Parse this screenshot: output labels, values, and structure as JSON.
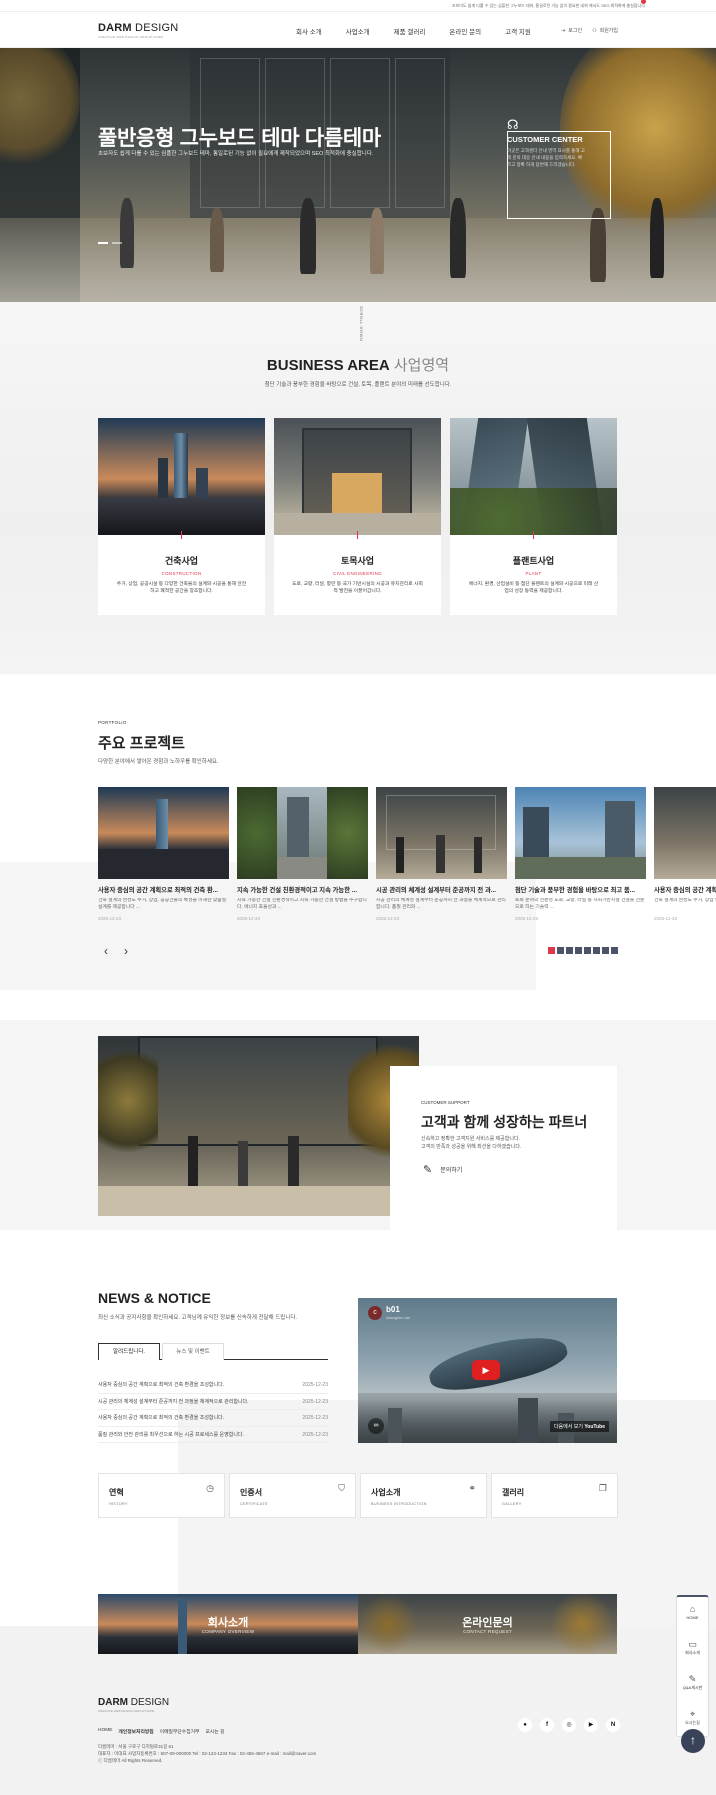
{
  "notice": "조보이도 쉽게 다룰 수 있는 심플한 그누보드 테마, 통일로된 기능 없이 필요한 네위 에서도 SEO 최적화에 충실합니다.",
  "header": {
    "logo_bold": "DARM",
    "logo_light": " DESIGN",
    "logo_tagline": "CREATIVE WEB DESIGN GROUP DARM",
    "nav": [
      "회사 소개",
      "사업소개",
      "제품 갤러리",
      "온라인 문의",
      "고객 지원"
    ],
    "login": "로그인",
    "join": "회원가입"
  },
  "hero": {
    "title": "풀반응형 그누보드 테마 다름테마",
    "subtitle": "초보자도 쉽게 다룰 수 있는 심플한 그누보드 테마, 통일로된 기능 없이 필요에게 제작되었으며 SEO 최적화에 충실합니다.",
    "cc_title": "CUSTOMER CENTER",
    "cc_desc": "이곳은 고객센터 안내 영역 표시를 통해 고객 문의 대응 안내 내용을 입력하세요. 빠르고 정확 하게 답변해 드리겠습니다.",
    "scroll": "SCROLL DOWN"
  },
  "business": {
    "title": "BUSINESS AREA",
    "title_kr": " 사업영역",
    "subtitle": "첨단 기술과 풍부한 경험을 바탕으로 건설, 토목, 플랜트 분야의 미래를 선도합니다.",
    "cards": [
      {
        "title": "건축사업",
        "en": "CONSTRUCTION",
        "desc": "주거, 상업, 공공시설 등 다양한 건축물의 설계와 시공을 통해 안전하고 쾌적한 공간을 창조합니다."
      },
      {
        "title": "토목사업",
        "en": "CIVIL ENGINEERING",
        "desc": "도로, 교량, 터널, 항만 등 국가 기반시설의 시공과 유지관리로 사회적 발전을 이끌어갑니다."
      },
      {
        "title": "플랜트사업",
        "en": "PLANT",
        "desc": "에너지, 환경, 산업설비 등 첨단 플랜트의 설계와 시공으로 미래 산업의 성장 동력을 제공합니다."
      }
    ]
  },
  "portfolio": {
    "label": "PORTFOLIO",
    "title": "주요 프로젝트",
    "subtitle": "다양한 분야에서 쌓아온 경험과 노하우를 확인하세요.",
    "items": [
      {
        "title": "사용자 중심의 공간 계획으로 최적의 건축 환...",
        "desc": "건축 설계의 완성도 주거, 상업, 공공건물의 특성을 이해한 맞춤형 설계를 제공합니다 ...",
        "date": "2025-12-23"
      },
      {
        "title": "지속 가능한 건설 친환경적이고 지속 가능한 ...",
        "desc": "지속 가능한 건설 친환경적이고 지속 가능한 건설 방법을 추구합니다. 에너지 효율성과 ...",
        "date": "2025-12-23"
      },
      {
        "title": "시공 관리의 체계성 설계부터 준공까지 전 과...",
        "desc": "시공 관리의 체계성 설계부터 준공까지 전 과정을 체계적으로 관리합니다. 품질 관리와 ...",
        "date": "2025-12-23"
      },
      {
        "title": "첨단 기술과 풍부한 경험을 바탕으로 최고 품...",
        "desc": "토목 분야의 전문성 도로, 교량, 터널 등 사회기반시설 건설을 전문으로 하는 기술력 ...",
        "date": "2025-12-23"
      },
      {
        "title": "사용자 중심의 공간 계획으로",
        "desc": "건축 설계의 완성도 주거, 상업 맞춤형 설계를 제공합니다",
        "date": "2025-12-23"
      }
    ]
  },
  "support": {
    "label": "CUSTOMER SUPPORT",
    "title": "고객과 함께 성장하는 파트너",
    "desc1": "신속하고 정확한 고객지원 서비스를 제공합니다.",
    "desc2": "고객의 만족과 성공을 위해 최선을 다하겠습니다.",
    "button": "문의하기"
  },
  "news": {
    "title": "NEWS & NOTICE",
    "subtitle": "최신 소식과 공지사항을 확인하세요. 고객님께 유익한 정보를 신속하게 전달해 드립니다.",
    "tabs": [
      "알려드립니다.",
      "뉴스 및 이벤트"
    ],
    "rows": [
      {
        "title": "사용자 중심의 공간 계획으로 최적의 건축 환경을 조성합니다.",
        "date": "2025-12-23"
      },
      {
        "title": "시공 관리의 체계성 설계부터 준공까지 전 과정을 체계적으로 관리합니다.",
        "date": "2025-12-23"
      },
      {
        "title": "사용자 중심의 공간 계획으로 최적의 건축 환경을 조성합니다.",
        "date": "2025-12-23"
      },
      {
        "title": "품질 관리와 안전 관리를 최우선으로 하는 시공 프로세스를 운영합니다.",
        "date": "2025-12-23"
      }
    ],
    "video": {
      "channel": "b01",
      "channel_sub": "changhun nw",
      "watch": "다음에서 보기",
      "brand": "YouTube"
    }
  },
  "quick_links": [
    {
      "title": "연혁",
      "en": "HISTORY",
      "icon": "clock-icon"
    },
    {
      "title": "인증서",
      "en": "CERTIFICATE",
      "icon": "shield-icon"
    },
    {
      "title": "사업소개",
      "en": "BUSINESS INTRODUCTION",
      "icon": "handshake-icon"
    },
    {
      "title": "갤러리",
      "en": "GALLERY",
      "icon": "gallery-icon"
    }
  ],
  "banners": [
    {
      "title": "회사소개",
      "en": "COMPANY OVERVIEW"
    },
    {
      "title": "온라인문의",
      "en": "CONTACT REQUEST"
    }
  ],
  "footer": {
    "links": [
      "HOME",
      "개인정보처리방침",
      "이메일무단수집거부",
      "오시는 길"
    ],
    "info1": "다름테마 : 서울 구로구 디지털로31길 61",
    "info2": "대표자 : 이대표     사업자등록번호 : 607-09-000000     Tel : 02-123-1234     Fax : 02-456-4567     e-mail : mail@naver.com",
    "copyright": "ⓒ 다름테마 All Rights Reserved.",
    "sns": [
      "talk",
      "f",
      "ig",
      "yt",
      "N"
    ]
  },
  "quick_menu": [
    {
      "label": "HOME",
      "icon": "home-icon"
    },
    {
      "label": "회사소개",
      "icon": "monitor-icon"
    },
    {
      "label": "Q&A게시판",
      "icon": "pen-icon"
    },
    {
      "label": "오시는길",
      "icon": "map-pin-icon"
    }
  ],
  "colors": {
    "accent": "#e0364a",
    "navy": "#384259"
  }
}
